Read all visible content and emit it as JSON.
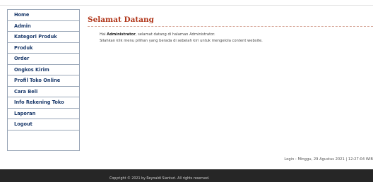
{
  "sidebar": {
    "items": [
      {
        "label": "Home"
      },
      {
        "label": "Admin"
      },
      {
        "label": "Kategori Produk"
      },
      {
        "label": "Produk"
      },
      {
        "label": "Order"
      },
      {
        "label": "Ongkos Kirim"
      },
      {
        "label": "Profil Toko Online"
      },
      {
        "label": "Cara Beli"
      },
      {
        "label": "Info Rekening Toko"
      },
      {
        "label": "Laporan"
      },
      {
        "label": "Logout"
      }
    ]
  },
  "main": {
    "title": "Selamat Datang",
    "greeting_prefix": "Hai ",
    "user": "Administrator",
    "greeting_suffix": ", selamat datang di halaman Administrator.",
    "instruction": "Silahkan klik menu pilihan yang berada di sebelah kiri untuk mengelola content website.",
    "login_info": "Login : Minggu, 29 Agustus 2021 | 12:27:04 WIB"
  },
  "footer": {
    "copyright": "Copyright © 2021 by Reynaldi Sianturi. All rights reserved."
  },
  "colors": {
    "title": "#b0361a",
    "menu_text": "#1b3a6b",
    "footer_bg": "#262626"
  }
}
